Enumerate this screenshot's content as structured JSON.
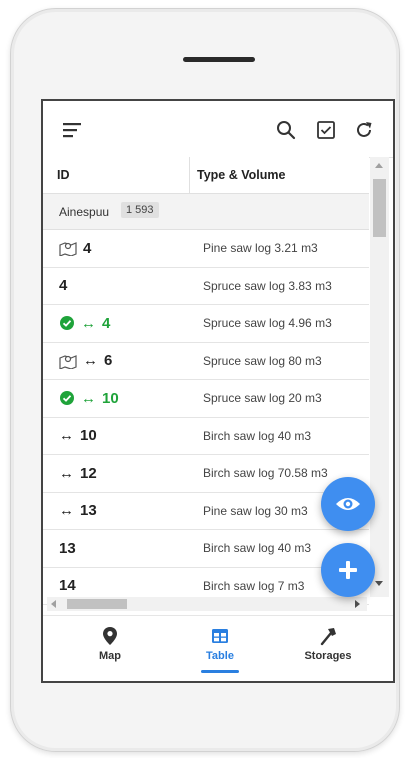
{
  "columns": {
    "id": "ID",
    "type_volume": "Type & Volume"
  },
  "group": {
    "name": "Ainespuu",
    "count": "1 593"
  },
  "rows": [
    {
      "id": "4",
      "icon": "map-pin-icon",
      "arrow": "",
      "green": false,
      "type_volume": "Pine saw log 3.21 m3"
    },
    {
      "id": "4",
      "icon": "",
      "arrow": "",
      "green": false,
      "type_volume": "Spruce saw log 3.83 m3"
    },
    {
      "id": "4",
      "icon": "check-circle-icon",
      "arrow": "↔",
      "green": true,
      "type_volume": "Spruce saw log 4.96 m3"
    },
    {
      "id": "6",
      "icon": "map-pin-icon",
      "arrow": "↔",
      "green": false,
      "type_volume": "Spruce saw log 80 m3"
    },
    {
      "id": "10",
      "icon": "check-circle-icon",
      "arrow": "↔",
      "green": true,
      "type_volume": "Spruce saw log 20 m3"
    },
    {
      "id": "10",
      "icon": "",
      "arrow": "↔",
      "green": false,
      "type_volume": "Birch saw log 40 m3"
    },
    {
      "id": "12",
      "icon": "",
      "arrow": "↔",
      "green": false,
      "type_volume": "Birch saw log 70.58 m3"
    },
    {
      "id": "13",
      "icon": "",
      "arrow": "↔",
      "green": false,
      "type_volume": "Pine saw log 30 m3"
    },
    {
      "id": "13",
      "icon": "",
      "arrow": "",
      "green": false,
      "type_volume": "Birch saw log 40 m3"
    },
    {
      "id": "14",
      "icon": "",
      "arrow": "",
      "green": false,
      "type_volume": "Birch saw log 7 m3"
    }
  ],
  "nav": {
    "map": "Map",
    "table": "Table",
    "storages": "Storages",
    "active": "Table"
  },
  "colors": {
    "accent": "#2a7fe0",
    "fab": "#3f8ef0",
    "green": "#1fa33a"
  }
}
